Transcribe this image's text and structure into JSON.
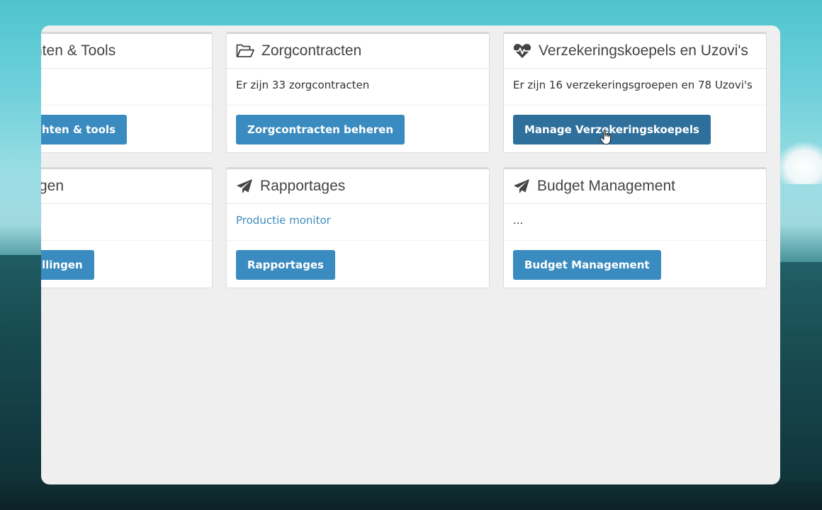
{
  "cards": [
    {
      "title": "nten & Tools",
      "body": "",
      "button": "hten & tools",
      "icon": "none"
    },
    {
      "title": "Zorgcontracten",
      "body": "Er zijn 33 zorgcontracten",
      "button": "Zorgcontracten beheren",
      "icon": "folder-open-icon"
    },
    {
      "title": "Verzekeringskoepels en Uzovi's",
      "body": "Er zijn 16 verzekeringsgroepen en 78 Uzovi's",
      "button": "Manage Verzekeringskoepels",
      "icon": "heartbeat-icon"
    },
    {
      "title": "gen",
      "body": "",
      "button": "llingen",
      "icon": "none"
    },
    {
      "title": "Rapportages",
      "body_link": "Productie monitor",
      "button": "Rapportages",
      "icon": "paper-plane-icon"
    },
    {
      "title": "Budget Management",
      "body": "...",
      "button": "Budget Management",
      "icon": "paper-plane-icon"
    }
  ],
  "colors": {
    "button": "#3a8bbf",
    "button_hover": "#2f6f9b",
    "link": "#3d8cba",
    "panel_bg": "#efefef"
  }
}
